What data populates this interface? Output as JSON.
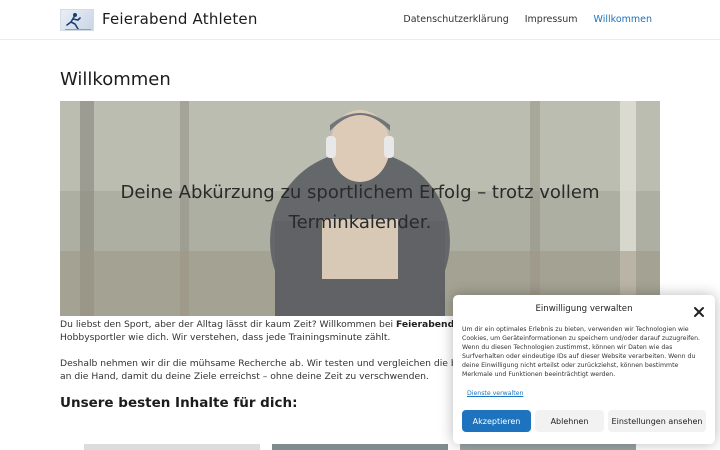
{
  "header": {
    "site_title": "Feierabend Athleten",
    "nav": [
      "Datenschutzerklärung",
      "Impressum",
      "Willkommen"
    ]
  },
  "main": {
    "page_title": "Willkommen",
    "hero_text": "Deine Abkürzung zu sportlichem Erfolg – trotz vollem Terminkalender.",
    "intro_1a": "Du liebst den Sport, aber der Alltag lässt dir kaum Zeit? Willkommen bei ",
    "intro_1b": "Feierabend Athleten",
    "intro_1c": ", d",
    "intro_2": "Hobbysportler wie dich. Wir verstehen, dass jede Trainingsminute zählt.",
    "intro_3": "Deshalb nehmen wir dir die mühsame Recherche ab. Wir testen und vergleichen die beste Ausrüs",
    "intro_4": "an die Hand, damit du deine Ziele erreichst – ohne deine Zeit zu verschwenden.",
    "section_heading": "Unsere besten Inhalte für dich:"
  },
  "consent": {
    "title": "Einwilligung verwalten",
    "body": "Um dir ein optimales Erlebnis zu bieten, verwenden wir Technologien wie Cookies, um Geräteinformationen zu speichern und/oder darauf zuzugreifen. Wenn du diesen Technologien zustimmst, können wir Daten wie das Surfverhalten oder eindeutige IDs auf dieser Website verarbeiten. Wenn du deine Einwilligung nicht erteilst oder zurückziehst, können bestimmte Merkmale und Funktionen beeinträchtigt werden.",
    "link": "Dienste verwalten",
    "accept": "Akzeptieren",
    "deny": "Ablehnen",
    "prefs": "Einstellungen ansehen"
  },
  "colors": {
    "accent": "#1e73be"
  }
}
